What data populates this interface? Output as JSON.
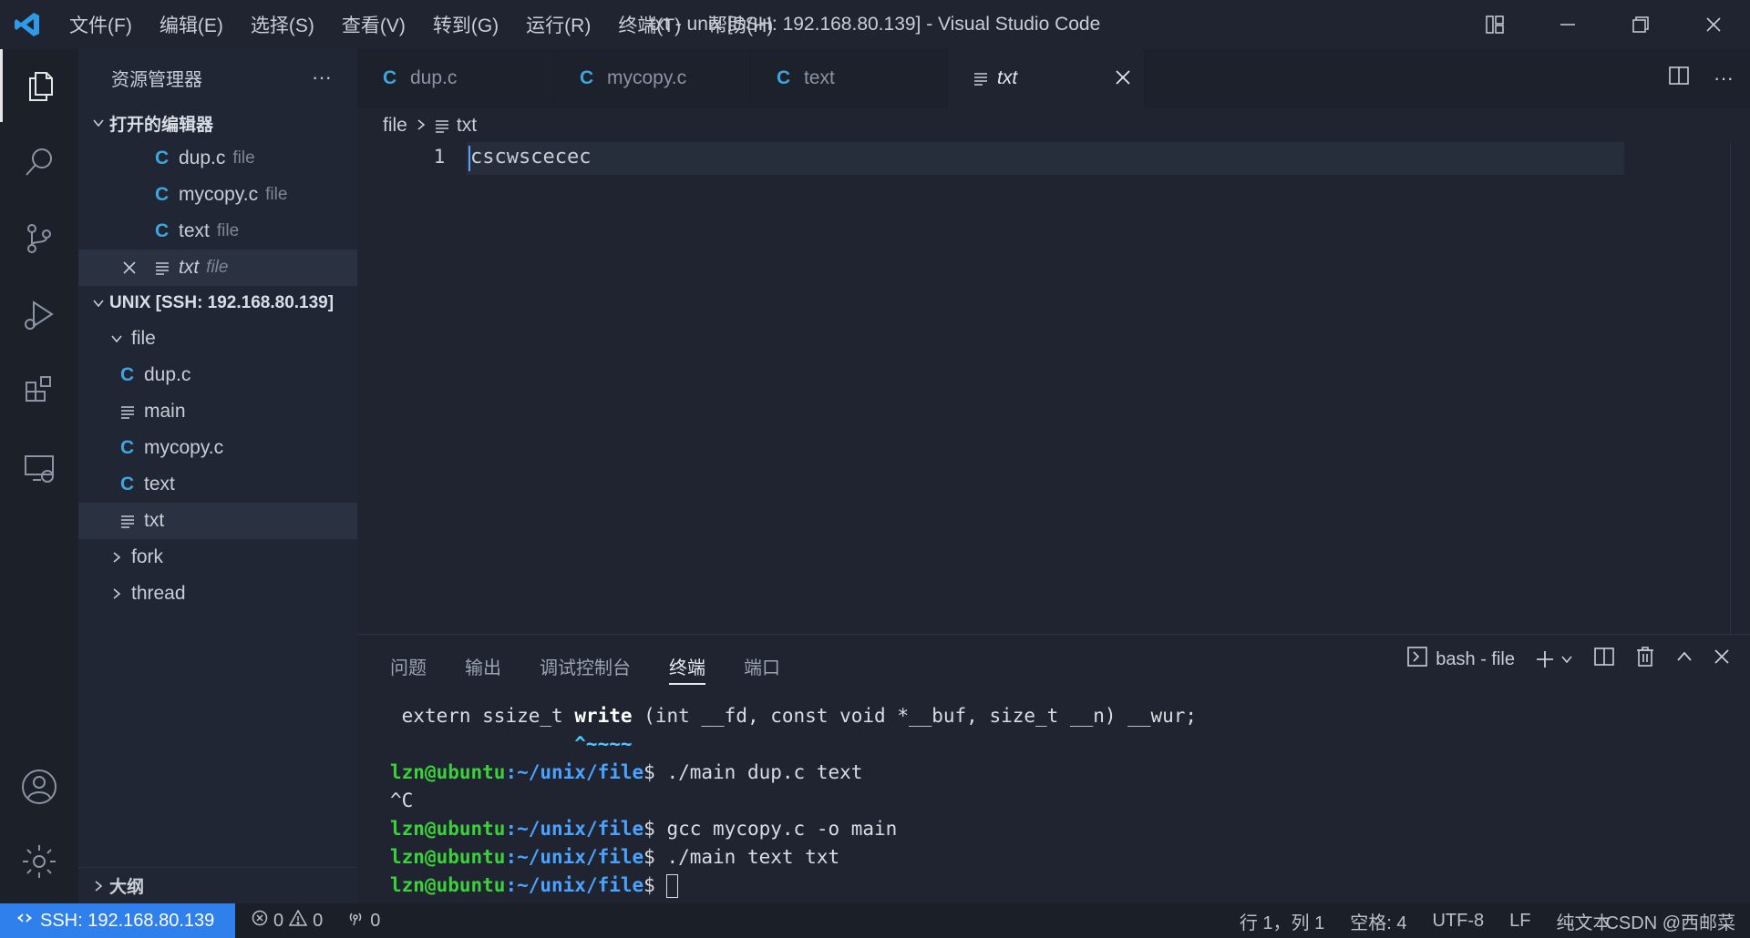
{
  "window": {
    "title": "txt - unix [SSH: 192.168.80.139] - Visual Studio Code",
    "menu": [
      "文件(F)",
      "编辑(E)",
      "选择(S)",
      "查看(V)",
      "转到(G)",
      "运行(R)",
      "终端(T)",
      "帮助(H)"
    ]
  },
  "sidebar": {
    "title": "资源管理器",
    "open_editors_label": "打开的编辑器",
    "open_editors": [
      {
        "name": "dup.c",
        "hint": "file",
        "icon": "c-file-icon"
      },
      {
        "name": "mycopy.c",
        "hint": "file",
        "icon": "c-file-icon"
      },
      {
        "name": "text",
        "hint": "file",
        "icon": "c-file-icon"
      },
      {
        "name": "txt",
        "hint": "file",
        "icon": "text-file-icon"
      }
    ],
    "workspace_label": "UNIX [SSH: 192.168.80.139]",
    "folder_file": "file",
    "files": [
      {
        "name": "dup.c",
        "icon": "c-file-icon"
      },
      {
        "name": "main",
        "icon": "text-file-icon"
      },
      {
        "name": "mycopy.c",
        "icon": "c-file-icon"
      },
      {
        "name": "text",
        "icon": "c-file-icon"
      },
      {
        "name": "txt",
        "icon": "text-file-icon"
      }
    ],
    "folder_fork": "fork",
    "folder_thread": "thread",
    "outline_label": "大纲",
    "c_letter": "C"
  },
  "tabs": [
    {
      "label": "dup.c",
      "icon": "c-file-icon"
    },
    {
      "label": "mycopy.c",
      "icon": "c-file-icon"
    },
    {
      "label": "text",
      "icon": "c-file-icon"
    },
    {
      "label": "txt",
      "icon": "text-file-icon",
      "active": true
    }
  ],
  "breadcrumb": {
    "folder": "file",
    "file": "txt"
  },
  "editor": {
    "line_number": "1",
    "content": "cscwscecec"
  },
  "panel": {
    "tabs": [
      "问题",
      "输出",
      "调试控制台",
      "终端",
      "端口"
    ],
    "active_tab": "终端",
    "terminal_name": "bash - file",
    "lines": {
      "l1_pre": "extern ssize_t ",
      "l1_kw": "write",
      "l1_post": " (int __fd, const void *__buf, size_t __n) __wur;",
      "l2": "                ^~~~~",
      "user": "lzn@ubuntu",
      "path": ":~/unix/file",
      "dollar": "$",
      "c1": " ./main dup.c text",
      "c1_out": "^C",
      "c2": " gcc mycopy.c -o main",
      "c3": " ./main text txt",
      "c4": " "
    }
  },
  "status": {
    "remote": "SSH: 192.168.80.139",
    "errors": "0",
    "warnings": "0",
    "ports": "0",
    "position": "行 1，列 1",
    "spaces": "空格: 4",
    "encoding": "UTF-8",
    "eol": "LF",
    "language": "纯文本",
    "watermark": "CSDN @西邮菜"
  },
  "colors": {
    "accent": "#3da5e0",
    "remote": "#2f80ed",
    "prompt_user": "#3ad13a",
    "prompt_path": "#4aa3ff"
  }
}
